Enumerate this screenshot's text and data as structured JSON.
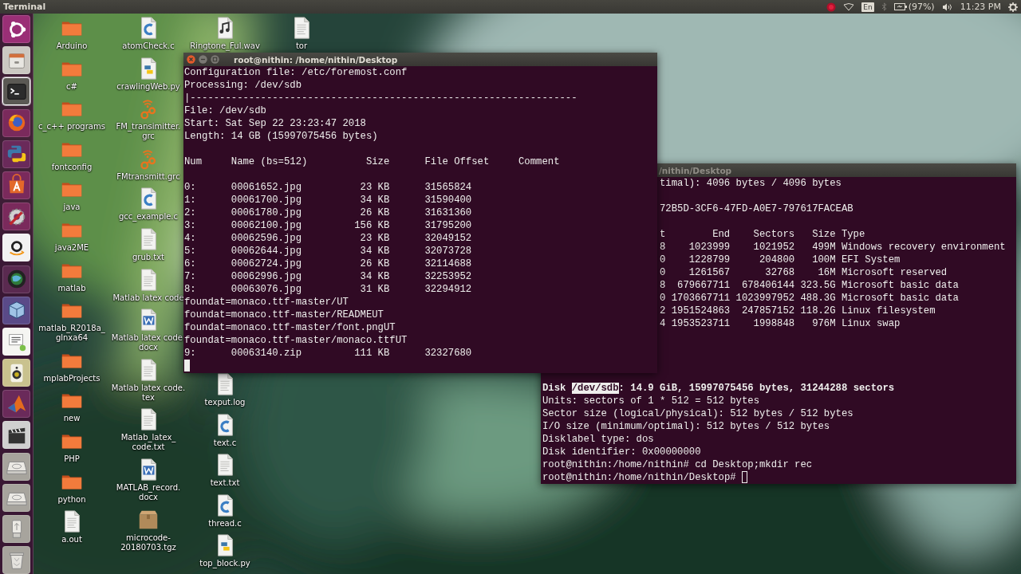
{
  "top_bar": {
    "app_title": "Terminal",
    "keyboard_layout": "En",
    "battery": "(97%)",
    "clock": "11:23 PM"
  },
  "launcher": [
    {
      "kind": "ubuntu",
      "selected": false
    },
    {
      "kind": "files",
      "selected": false
    },
    {
      "kind": "terminal",
      "selected": true
    },
    {
      "kind": "firefox",
      "selected": false
    },
    {
      "kind": "python",
      "selected": false
    },
    {
      "kind": "software",
      "selected": false
    },
    {
      "kind": "tools",
      "selected": false
    },
    {
      "kind": "shop",
      "selected": false
    },
    {
      "kind": "globe",
      "selected": false
    },
    {
      "kind": "cube",
      "selected": false
    },
    {
      "kind": "tex",
      "selected": false
    },
    {
      "kind": "speaker",
      "selected": false
    },
    {
      "kind": "membrane",
      "selected": false
    },
    {
      "kind": "clapper",
      "selected": false
    },
    {
      "kind": "drive",
      "selected": false
    },
    {
      "kind": "drive",
      "selected": false
    },
    {
      "kind": "usb",
      "selected": false
    },
    {
      "kind": "trash",
      "selected": false
    }
  ],
  "desktop_icons": {
    "columns": [
      [
        {
          "label": "Arduino",
          "kind": "folder"
        },
        {
          "label": "c#",
          "kind": "folder"
        },
        {
          "label": "c_c++ programs",
          "kind": "folder"
        },
        {
          "label": "fontconfig",
          "kind": "folder"
        },
        {
          "label": "java",
          "kind": "folder"
        },
        {
          "label": "java2ME",
          "kind": "folder"
        },
        {
          "label": "matlab",
          "kind": "folder"
        },
        {
          "label": "matlab_R2018a_glnxa64",
          "kind": "folder"
        },
        {
          "label": "mplabProjects",
          "kind": "folder"
        },
        {
          "label": "new",
          "kind": "folder"
        },
        {
          "label": "PHP",
          "kind": "folder"
        },
        {
          "label": "python",
          "kind": "folder"
        },
        {
          "label": "a.out",
          "kind": "text"
        }
      ],
      [
        {
          "label": "atomCheck.c",
          "kind": "c"
        },
        {
          "label": "crawlingWeb.py",
          "kind": "py"
        },
        {
          "label": "FM_transimitter.grc",
          "kind": "grc"
        },
        {
          "label": "FMtransmitt.grc",
          "kind": "grc"
        },
        {
          "label": "gcc_example.c",
          "kind": "c"
        },
        {
          "label": "grub.txt",
          "kind": "text"
        },
        {
          "label": "Matlab latex code",
          "kind": "text"
        },
        {
          "label": "Matlab latex code.docx",
          "kind": "docx"
        },
        {
          "label": "Matlab latex code.tex",
          "kind": "text"
        },
        {
          "label": "Matlab_latex_code.txt",
          "kind": "text"
        },
        {
          "label": "MATLAB_record.docx",
          "kind": "docx"
        },
        {
          "label": "microcode-20180703.tgz",
          "kind": "tgz"
        }
      ],
      [
        {
          "label": "Ringtone_Ful.wav",
          "kind": "wav"
        },
        {
          "label": "texput.log",
          "kind": "text"
        },
        {
          "label": "text.c",
          "kind": "c"
        },
        {
          "label": "text.txt",
          "kind": "text"
        },
        {
          "label": "thread.c",
          "kind": "c"
        },
        {
          "label": "top_block.py",
          "kind": "py"
        }
      ],
      [
        {
          "label": "tor",
          "kind": "text"
        }
      ]
    ]
  },
  "terminals": [
    {
      "title": "root@nithin: /home/nithin/Desktop",
      "active": true,
      "lines": [
        {
          "kind": "text",
          "text": "Configuration file: /etc/foremost.conf"
        },
        {
          "kind": "text",
          "text": "Processing: /dev/sdb"
        },
        {
          "kind": "text",
          "text": "|------------------------------------------------------------------"
        },
        {
          "kind": "text",
          "text": "File: /dev/sdb"
        },
        {
          "kind": "text",
          "text": "Start: Sat Sep 22 23:23:47 2018"
        },
        {
          "kind": "text",
          "text": "Length: 14 GB (15997075456 bytes)"
        },
        {
          "kind": "blank"
        },
        {
          "kind": "text",
          "text": "Num     Name (bs=512)          Size      File Offset     Comment"
        },
        {
          "kind": "blank"
        },
        {
          "kind": "text",
          "text": "0:      00061652.jpg          23 KB      31565824"
        },
        {
          "kind": "text",
          "text": "1:      00061700.jpg          34 KB      31590400"
        },
        {
          "kind": "text",
          "text": "2:      00061780.jpg          26 KB      31631360"
        },
        {
          "kind": "text",
          "text": "3:      00062100.jpg         156 KB      31795200"
        },
        {
          "kind": "text",
          "text": "4:      00062596.jpg          23 KB      32049152"
        },
        {
          "kind": "text",
          "text": "5:      00062644.jpg          34 KB      32073728"
        },
        {
          "kind": "text",
          "text": "6:      00062724.jpg          26 KB      32114688"
        },
        {
          "kind": "text",
          "text": "7:      00062996.jpg          34 KB      32253952"
        },
        {
          "kind": "text",
          "text": "8:      00063076.jpg          31 KB      32294912"
        },
        {
          "kind": "text",
          "text": "foundat=monaco.ttf-master/UT"
        },
        {
          "kind": "text",
          "text": "foundat=monaco.ttf-master/READMEUT"
        },
        {
          "kind": "text",
          "text": "foundat=monaco.ttf-master/font.pngUT"
        },
        {
          "kind": "text",
          "text": "foundat=monaco.ttf-master/monaco.ttfUT"
        },
        {
          "kind": "text",
          "text": "9:      00063140.zip         111 KB      32327680"
        },
        {
          "kind": "cursor"
        }
      ]
    },
    {
      "title": "/nithin/Desktop",
      "active": false,
      "upper_lines": [
        {
          "kind": "text",
          "text": "timal): 4096 bytes / 4096 bytes"
        },
        {
          "kind": "blank"
        },
        {
          "kind": "text",
          "text": "72B5D-3CF6-47FD-A0E7-797617FACEAB"
        },
        {
          "kind": "blank"
        },
        {
          "kind": "text",
          "text": "t        End    Sectors   Size Type"
        },
        {
          "kind": "text",
          "text": "8    1023999    1021952   499M Windows recovery environment"
        },
        {
          "kind": "text",
          "text": "0    1228799     204800   100M EFI System"
        },
        {
          "kind": "text",
          "text": "0    1261567      32768    16M Microsoft reserved"
        },
        {
          "kind": "text",
          "text": "8  679667711  678406144 323.5G Microsoft basic data"
        },
        {
          "kind": "text",
          "text": "0 1703667711 1023997952 488.3G Microsoft basic data"
        },
        {
          "kind": "text",
          "text": "2 1951524863  247857152 118.2G Linux filesystem"
        },
        {
          "kind": "text",
          "text": "4 1953523711    1998848   976M Linux swap"
        }
      ],
      "lines": [
        {
          "kind": "bold",
          "segments": [
            {
              "text": "Disk ",
              "selected": false
            },
            {
              "text": "/dev/sdb",
              "selected": true
            },
            {
              "text": ": 14.9 GiB, 15997075456 bytes, 31244288 sectors",
              "selected": false
            }
          ]
        },
        {
          "kind": "text",
          "text": "Units: sectors of 1 * 512 = 512 bytes"
        },
        {
          "kind": "text",
          "text": "Sector size (logical/physical): 512 bytes / 512 bytes"
        },
        {
          "kind": "text",
          "text": "I/O size (minimum/optimal): 512 bytes / 512 bytes"
        },
        {
          "kind": "text",
          "text": "Disklabel type: dos"
        },
        {
          "kind": "text",
          "text": "Disk identifier: 0x00000000"
        },
        {
          "kind": "text",
          "text": "root@nithin:/home/nithin# cd Desktop;mkdir rec"
        },
        {
          "kind": "prompt",
          "text": "root@nithin:/home/nithin/Desktop# "
        }
      ]
    }
  ]
}
